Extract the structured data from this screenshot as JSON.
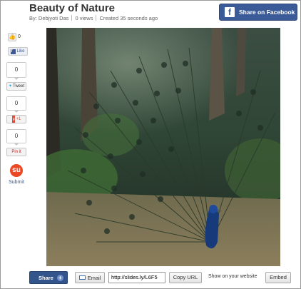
{
  "header": {
    "title": "Beauty of Nature",
    "author": "By: Debjyoti Das",
    "views": "0 views",
    "created": "Created 35 seconds ago"
  },
  "facebook_share_button": {
    "label": "Share on Facebook"
  },
  "social": {
    "facebook_like": {
      "count": "0",
      "label": "Like"
    },
    "tweet": {
      "count": "0",
      "label": "Tweet"
    },
    "google_plus": {
      "count": "0",
      "label": "+1"
    },
    "pinterest": {
      "count": "0",
      "label": "Pin it"
    },
    "stumbleupon": {
      "label": "Submit"
    }
  },
  "bottom_bar": {
    "share_label": "Share",
    "email_label": "Email",
    "url_value": "http://slides.ly/L6F5",
    "copy_label": "Copy URL",
    "show_label": "Show on your website",
    "embed_label": "Embed"
  },
  "colors": {
    "facebook_blue": "#3b5b98",
    "stumbleupon_orange": "#eb4924",
    "google_red": "#dd4b39",
    "pinterest_red": "#cb2027",
    "twitter_blue": "#2aa9e0"
  }
}
